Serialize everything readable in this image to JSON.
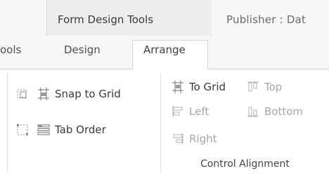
{
  "contextual": {
    "left_fragment": "",
    "band_title": "Form Design Tools",
    "app_title": "Publisher : Dat"
  },
  "tabs": {
    "tools_fragment": "ools",
    "design": "Design",
    "arrange": "Arrange"
  },
  "sizing_group": {
    "snap_to_grid": "Snap to Grid",
    "tab_order": "Tab Order"
  },
  "alignment_group": {
    "to_grid": "To Grid",
    "top": "Top",
    "left": "Left",
    "bottom": "Bottom",
    "right": "Right",
    "group_title": "Control Alignment"
  },
  "icons": {
    "size_to_grid": "size-to-grid-icon",
    "snap_to_grid": "snap-to-grid-icon",
    "anchor": "anchor-icon",
    "tab_order": "tab-order-icon",
    "to_grid": "to-grid-icon",
    "align_top": "align-top-icon",
    "align_left": "align-left-icon",
    "align_bottom": "align-bottom-icon",
    "align_right": "align-right-icon"
  },
  "colors": {
    "active_tab_bg": "#ffffff",
    "contextual_band_bg": "#ededed",
    "ribbon_bg": "#ffffff",
    "disabled_text": "#a7a7a7"
  }
}
